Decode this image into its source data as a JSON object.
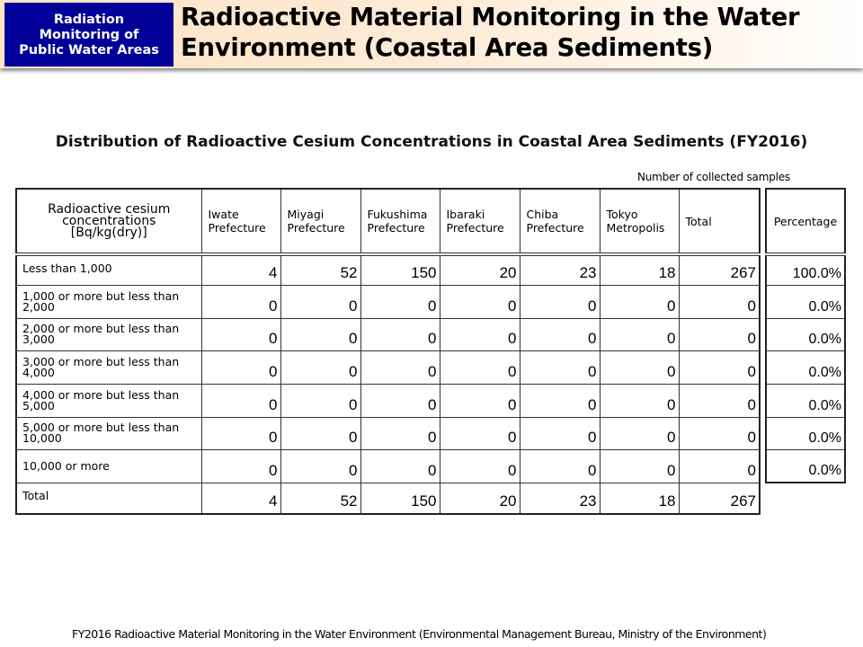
{
  "header": {
    "badge_lines": [
      "Radiation",
      "Monitoring of",
      "Public Water Areas"
    ],
    "title_lines": [
      "Radioactive Material Monitoring in the Water",
      "Environment (Coastal Area Sediments)"
    ],
    "colors": {
      "badge_bg": "#000099",
      "band_start": "#fde3c4"
    }
  },
  "subtitle": "Distribution of Radioactive Cesium Concentrations in Coastal Area Sediments (FY2016)",
  "unit_note": "Number of collected samples",
  "table": {
    "first_header": [
      "Radioactive cesium",
      "concentrations",
      "[Bq/kg(dry)]"
    ],
    "columns": [
      [
        "Iwate",
        "Prefecture"
      ],
      [
        "Miyagi",
        "Prefecture"
      ],
      [
        "Fukushima",
        "Prefecture"
      ],
      [
        "Ibaraki",
        "Prefecture"
      ],
      [
        "Chiba",
        "Prefecture"
      ],
      [
        "Tokyo",
        "Metropolis"
      ],
      [
        "Total"
      ]
    ],
    "rows": [
      {
        "label": [
          "Less than 1,000"
        ],
        "values": [
          "4",
          "52",
          "150",
          "20",
          "23",
          "18",
          "267"
        ],
        "percentage": "100.0%"
      },
      {
        "label": [
          "1,000 or more but less than",
          "2,000"
        ],
        "values": [
          "0",
          "0",
          "0",
          "0",
          "0",
          "0",
          "0"
        ],
        "percentage": "0.0%"
      },
      {
        "label": [
          "2,000 or more but less than",
          "3,000"
        ],
        "values": [
          "0",
          "0",
          "0",
          "0",
          "0",
          "0",
          "0"
        ],
        "percentage": "0.0%"
      },
      {
        "label": [
          "3,000 or more but less than",
          "4,000"
        ],
        "values": [
          "0",
          "0",
          "0",
          "0",
          "0",
          "0",
          "0"
        ],
        "percentage": "0.0%"
      },
      {
        "label": [
          "4,000 or more but less than",
          "5,000"
        ],
        "values": [
          "0",
          "0",
          "0",
          "0",
          "0",
          "0",
          "0"
        ],
        "percentage": "0.0%"
      },
      {
        "label": [
          "5,000 or more but less than",
          "10,000"
        ],
        "values": [
          "0",
          "0",
          "0",
          "0",
          "0",
          "0",
          "0"
        ],
        "percentage": "0.0%"
      },
      {
        "label": [
          "10,000 or more"
        ],
        "values": [
          "0",
          "0",
          "0",
          "0",
          "0",
          "0",
          "0"
        ],
        "percentage": "0.0%"
      }
    ],
    "total_row": {
      "label": "Total",
      "values": [
        "4",
        "52",
        "150",
        "20",
        "23",
        "18",
        "267"
      ]
    },
    "percentage_header": "Percentage"
  },
  "footer": "FY2016 Radioactive Material Monitoring  in the Water Environment  (Environmental Management Bureau, Ministry of the Environment)"
}
